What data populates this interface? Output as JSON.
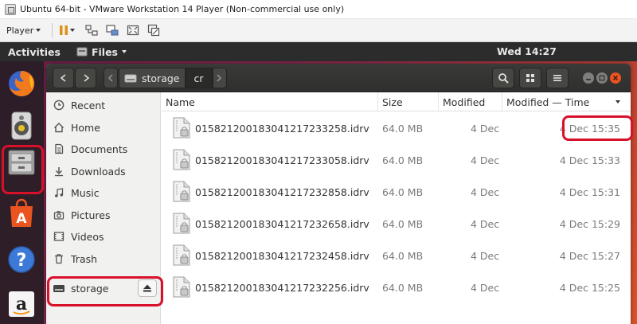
{
  "vm_window": {
    "title": "Ubuntu 64-bit - VMware Workstation 14 Player (Non-commercial use only)",
    "player_menu_label": "Player"
  },
  "top_bar": {
    "activities_label": "Activities",
    "app_menu_label": "Files",
    "clock": "Wed 14:27"
  },
  "dock": {
    "items": [
      "firefox-icon",
      "rhythmbox-icon",
      "files-icon",
      "software-center-icon",
      "help-icon",
      "amazon-icon"
    ],
    "highlighted": "files-icon"
  },
  "path_bar": {
    "segments": [
      "storage",
      "cr"
    ],
    "current": "cr"
  },
  "sidebar": {
    "items": [
      {
        "label": "Recent",
        "icon": "clock-icon"
      },
      {
        "label": "Home",
        "icon": "home-icon"
      },
      {
        "label": "Documents",
        "icon": "document-icon"
      },
      {
        "label": "Downloads",
        "icon": "download-icon"
      },
      {
        "label": "Music",
        "icon": "music-icon"
      },
      {
        "label": "Pictures",
        "icon": "camera-icon"
      },
      {
        "label": "Videos",
        "icon": "video-icon"
      },
      {
        "label": "Trash",
        "icon": "trash-icon"
      }
    ],
    "device": {
      "label": "storage",
      "icon": "drive-icon"
    }
  },
  "file_list": {
    "columns": [
      "Name",
      "Size",
      "Modified",
      "Modified — Time"
    ],
    "rows": [
      {
        "name": "01582120018304121723325​8.idrv",
        "size": "64.0 MB",
        "modified": "4 Dec",
        "modified_time": "4 Dec 15:35"
      },
      {
        "name": "015821200183041217233058.idrv",
        "size": "64.0 MB",
        "modified": "4 Dec",
        "modified_time": "4 Dec 15:33"
      },
      {
        "name": "015821200183041217232858.idrv",
        "size": "64.0 MB",
        "modified": "4 Dec",
        "modified_time": "4 Dec 15:31"
      },
      {
        "name": "015821200183041217232658.idrv",
        "size": "64.0 MB",
        "modified": "4 Dec",
        "modified_time": "4 Dec 15:29"
      },
      {
        "name": "015821200183041217232458.idrv",
        "size": "64.0 MB",
        "modified": "4 Dec",
        "modified_time": "4 Dec 15:27"
      },
      {
        "name": "015821200183041217232256.idrv",
        "size": "64.0 MB",
        "modified": "4 Dec",
        "modified_time": "4 Dec 15:25"
      }
    ]
  },
  "colors": {
    "annotation": "#d8102a",
    "accent": "#e95420"
  }
}
